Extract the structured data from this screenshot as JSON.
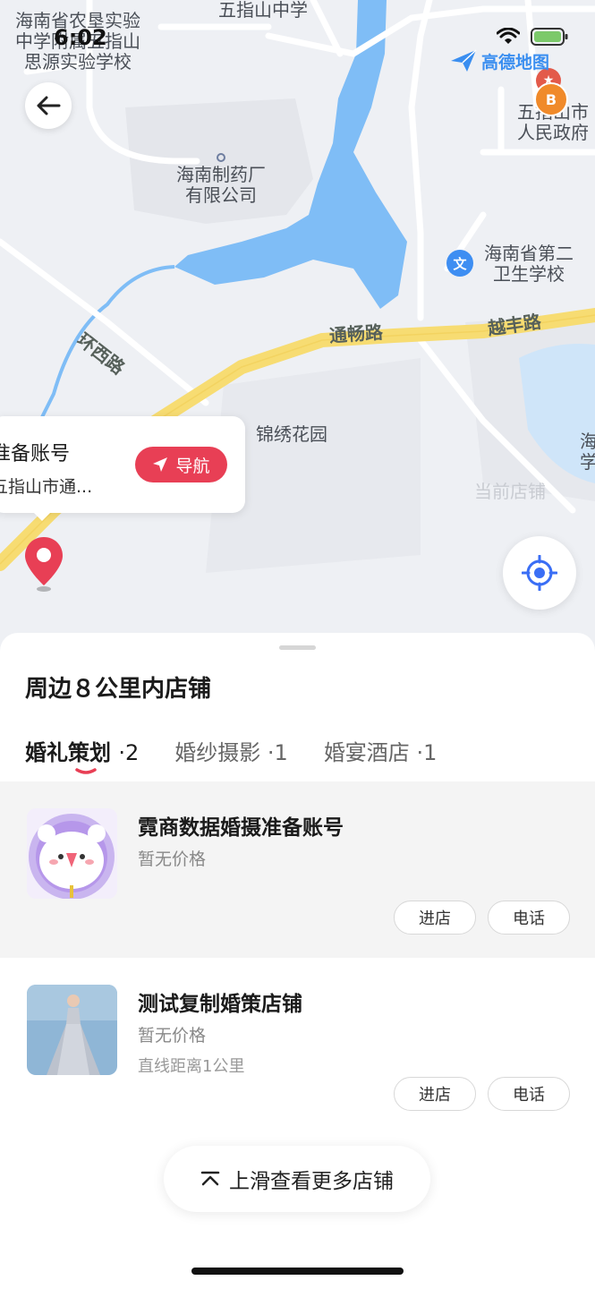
{
  "status": {
    "time": "6:02"
  },
  "map": {
    "labels": {
      "school1": "海南省农垦实验中学附属五指山思源实验学校",
      "school_top": "五指山中学",
      "pharma": "海南制药厂有限公司",
      "gov": "五指山市人民政府",
      "health_school": "海南省第二卫生学校",
      "huanxi": "环西路",
      "tongchang": "通畅路",
      "yuefeng": "越丰路",
      "jinxiu": "锦绣花园",
      "edge": "海学",
      "current_store": "当前店铺"
    },
    "logo": "高德地图",
    "popup": {
      "title": "准备账号",
      "address": "五指山市通...",
      "nav_label": "导航"
    },
    "colors": {
      "water": "#7fbdf6",
      "road_major": "#f7dc72",
      "pin": "#e83f55",
      "locate": "#3a6ef5"
    }
  },
  "sheet": {
    "title": "周边８公里内店铺",
    "tabs": [
      {
        "label": "婚礼策划",
        "count": "·2",
        "active": true
      },
      {
        "label": "婚纱摄影",
        "count": "·1",
        "active": false
      },
      {
        "label": "婚宴酒店",
        "count": "·1",
        "active": false
      }
    ],
    "shops": [
      {
        "name": "霓商数据婚摄准备账号",
        "price": "暂无价格",
        "distance": "",
        "enter": "进店",
        "call": "电话",
        "thumb": "bear-avatar"
      },
      {
        "name": "测试复制婚策店铺",
        "price": "暂无价格",
        "distance": "直线距离1公里",
        "enter": "进店",
        "call": "电话",
        "thumb": "bride-photo"
      }
    ],
    "more_label": "上滑查看更多店铺"
  }
}
